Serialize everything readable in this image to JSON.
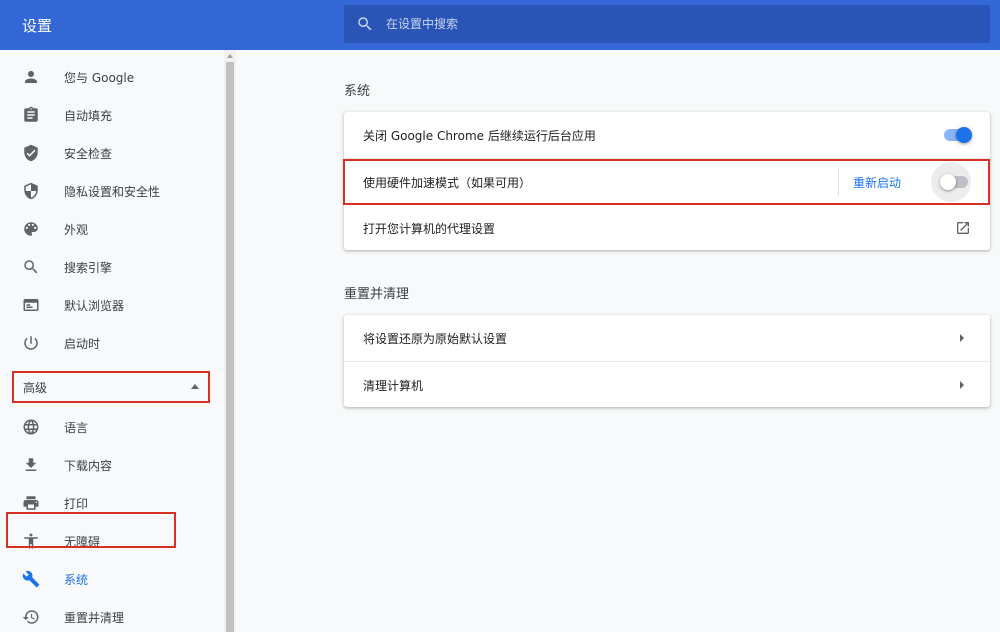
{
  "header": {
    "title": "设置",
    "search_placeholder": "在设置中搜索"
  },
  "sidebar": {
    "items": [
      {
        "label": "您与 Google",
        "icon": "person-icon"
      },
      {
        "label": "自动填充",
        "icon": "clipboard-icon"
      },
      {
        "label": "安全检查",
        "icon": "shield-check-icon"
      },
      {
        "label": "隐私设置和安全性",
        "icon": "shield-half-icon"
      },
      {
        "label": "外观",
        "icon": "palette-icon"
      },
      {
        "label": "搜索引擎",
        "icon": "search-icon"
      },
      {
        "label": "默认浏览器",
        "icon": "browser-icon"
      },
      {
        "label": "启动时",
        "icon": "power-icon"
      }
    ],
    "advanced_label": "高级",
    "advanced_items": [
      {
        "label": "语言",
        "icon": "globe-icon"
      },
      {
        "label": "下载内容",
        "icon": "download-icon"
      },
      {
        "label": "打印",
        "icon": "printer-icon"
      },
      {
        "label": "无障碍",
        "icon": "accessibility-icon"
      },
      {
        "label": "系统",
        "icon": "wrench-icon",
        "active": true
      },
      {
        "label": "重置并清理",
        "icon": "history-icon"
      }
    ]
  },
  "main": {
    "system_section": {
      "title": "系统",
      "rows": [
        {
          "label": "关闭 Google Chrome 后继续运行后台应用",
          "toggle": true
        },
        {
          "label": "使用硬件加速模式（如果可用）",
          "toggle": false,
          "action": "重新启动"
        },
        {
          "label": "打开您计算机的代理设置",
          "icon": "open-in-new-icon"
        }
      ]
    },
    "reset_section": {
      "title": "重置并清理",
      "rows": [
        {
          "label": "将设置还原为原始默认设置"
        },
        {
          "label": "清理计算机"
        }
      ]
    }
  },
  "colors": {
    "header_bg": "#3367d6",
    "search_bg": "#2a54b6",
    "accent": "#1a73e8",
    "highlight_border": "#d93025"
  }
}
